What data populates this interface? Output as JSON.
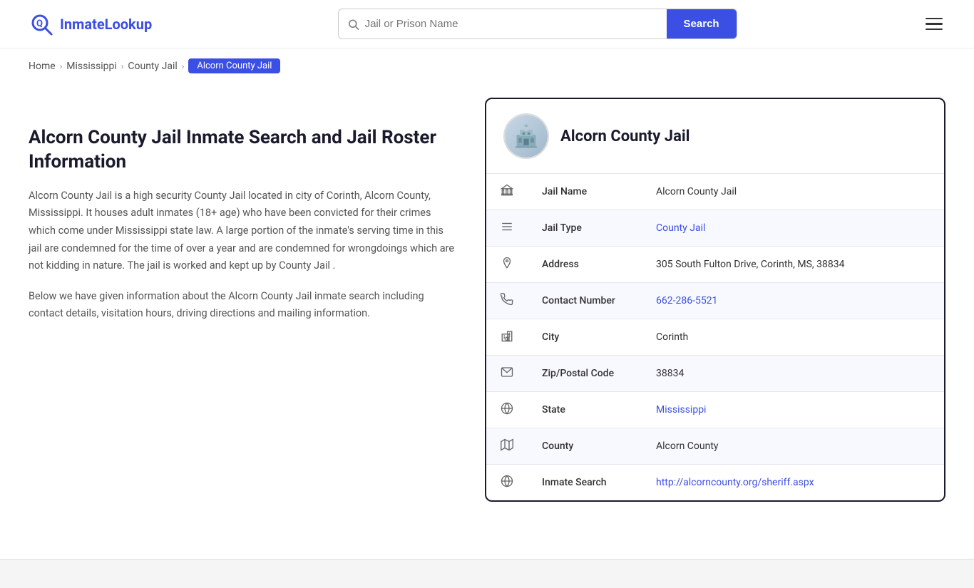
{
  "site": {
    "name_part1": "Inmate",
    "name_part2": "Lookup"
  },
  "header": {
    "search_placeholder": "Jail or Prison Name",
    "search_button_label": "Search"
  },
  "breadcrumb": {
    "home": "Home",
    "state": "Mississippi",
    "type": "County Jail",
    "active": "Alcorn County Jail"
  },
  "page": {
    "title": "Alcorn County Jail Inmate Search and Jail Roster Information",
    "description": "Alcorn County Jail is a high security County Jail located in city of Corinth, Alcorn County, Mississippi. It houses adult inmates (18+ age) who have been convicted for their crimes which come under Mississippi state law. A large portion of the inmate's serving time in this jail are condemned for the time of over a year and are condemned for wrongdoings which are not kidding in nature. The jail is worked and kept up by County Jail .",
    "sub_description": "Below we have given information about the Alcorn County Jail inmate search including contact details, visitation hours, driving directions and mailing information."
  },
  "jail_card": {
    "title": "Alcorn County Jail",
    "fields": [
      {
        "icon": "🏛",
        "label": "Jail Name",
        "value": "Alcorn County Jail",
        "type": "text"
      },
      {
        "icon": "≡",
        "label": "Jail Type",
        "value": "County Jail",
        "type": "link",
        "href": "#"
      },
      {
        "icon": "📍",
        "label": "Address",
        "value": "305 South Fulton Drive, Corinth, MS, 38834",
        "type": "text"
      },
      {
        "icon": "📞",
        "label": "Contact Number",
        "value": "662-286-5521",
        "type": "link",
        "href": "tel:662-286-5521"
      },
      {
        "icon": "🏙",
        "label": "City",
        "value": "Corinth",
        "type": "text"
      },
      {
        "icon": "✉",
        "label": "Zip/Postal Code",
        "value": "38834",
        "type": "text"
      },
      {
        "icon": "🌐",
        "label": "State",
        "value": "Mississippi",
        "type": "link",
        "href": "#"
      },
      {
        "icon": "🗺",
        "label": "County",
        "value": "Alcorn County",
        "type": "text"
      },
      {
        "icon": "🌍",
        "label": "Inmate Search",
        "value": "http://alcorncounty.org/sheriff.aspx",
        "type": "link",
        "href": "http://alcorncounty.org/sheriff.aspx"
      }
    ]
  }
}
